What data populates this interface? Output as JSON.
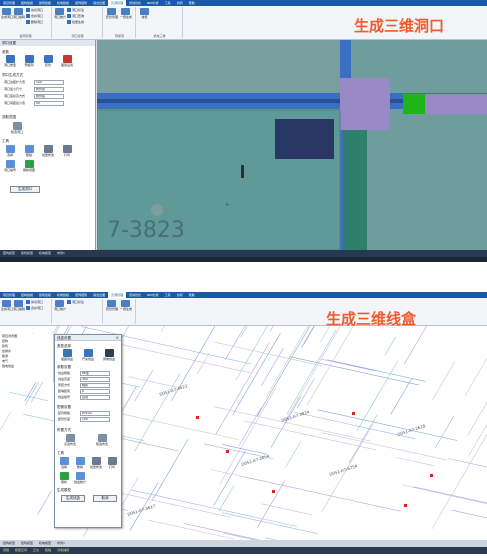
{
  "top": {
    "menu": [
      "项目管理",
      "结构建模",
      "建筑建模",
      "机电建模",
      "装饰装修",
      "综合出图",
      "孔洞管理",
      "管综优化",
      "BIM分析",
      "工具",
      "协同",
      "帮助"
    ],
    "active_menu": "孔洞管理",
    "banner": "生成三维洞口",
    "ribbon": {
      "groups": [
        "留洞管理",
        "洞口管理",
        "预留洞",
        "预埋套管",
        "机电三维"
      ],
      "buttons": [
        "生成洞口",
        "洞口编辑",
        "洞口统计",
        "套管管理",
        "一键生成",
        "校核"
      ],
      "small": [
        "剪切洞口",
        "合并洞口",
        "删除洞口",
        "洞口标注",
        "洞口查询",
        "批量生成"
      ]
    },
    "panel": {
      "title": "洞口设置",
      "section_params": "参数",
      "buttons": [
        "洞口类型",
        "预留洞",
        "套管",
        "图层设置"
      ],
      "section_rule": "洞口生成方式",
      "rows": [
        {
          "k": "洞口边距扩大值",
          "v": "100"
        },
        {
          "k": "洞口最小尺寸",
          "v": "按管径"
        },
        {
          "k": "洞口底标高方式",
          "v": "按管底"
        },
        {
          "k": "洞口间距最小值",
          "v": "50"
        }
      ],
      "section_pick": "选取范围",
      "pick_button": "框选洞口",
      "section_tools": "工具",
      "tools": [
        "选择",
        "删除",
        "批量修改",
        "打印",
        "洞口编号",
        "刷新视图"
      ],
      "generate_label": "生成洞口"
    },
    "tabs": [
      "结构模型",
      "建筑模型",
      "机电模型",
      "布局1"
    ],
    "wall_label": "7-3823"
  },
  "bottom": {
    "menu": [
      "项目管理",
      "结构建模",
      "建筑建模",
      "机电建模",
      "装饰装修",
      "综合出图",
      "孔洞管理",
      "管综优化",
      "BIM分析",
      "工具",
      "协同",
      "帮助"
    ],
    "active_menu": "孔洞管理",
    "banner": "生成三维线盒",
    "dialog": {
      "title": "线盒设置",
      "section_type": "类型选择",
      "types": [
        "插座线盒",
        "开关线盒",
        "弱电线盒"
      ],
      "section_params": "参数设置",
      "rows": [
        {
          "k": "线盒规格",
          "v": "86型"
        },
        {
          "k": "线盒高度",
          "v": "300"
        },
        {
          "k": "安装方式",
          "v": "暗装"
        },
        {
          "k": "距墙距离",
          "v": "0"
        },
        {
          "k": "线盒编号",
          "v": "自动"
        }
      ],
      "section_pipe": "配管设置",
      "pipe_rows": [
        {
          "k": "配管规格",
          "v": "PVC20"
        },
        {
          "k": "配管长度",
          "v": "100"
        }
      ],
      "section_pick": "布置方式",
      "pick_buttons": [
        "点选布置",
        "框选布置"
      ],
      "section_tools": "工具",
      "tools": [
        "选择",
        "删除",
        "批量修改",
        "打印",
        "刷新",
        "线盒统计"
      ],
      "section_gen": "生成模型",
      "gen_buttons": [
        "生成线盒",
        "取消"
      ]
    },
    "tree": [
      "项目浏览器",
      "结构",
      "建筑",
      "给排水",
      "暖通",
      "电气",
      "强电线盒"
    ],
    "tabs": [
      "结构模型",
      "建筑模型",
      "机电模型",
      "布局1"
    ],
    "status": [
      "就绪",
      "模型空间",
      "正交",
      "极轴",
      "对象捕捉"
    ],
    "room_labels": [
      "D051-A7-4623",
      "D051-A7-3824",
      "D051-A7-2654",
      "D051-A7-6754",
      "D051-A7-3617",
      "D051-A7-2618"
    ]
  },
  "colors": {
    "accent": "#f25a2c",
    "ribbon_blue": "#1b5aa7",
    "wall_teal": "#6f9c9d",
    "duct_blue": "#3b6fc4",
    "pipe_purple": "#9a89c7",
    "pipe_green": "#1fb51a",
    "box_navy": "#283763"
  }
}
